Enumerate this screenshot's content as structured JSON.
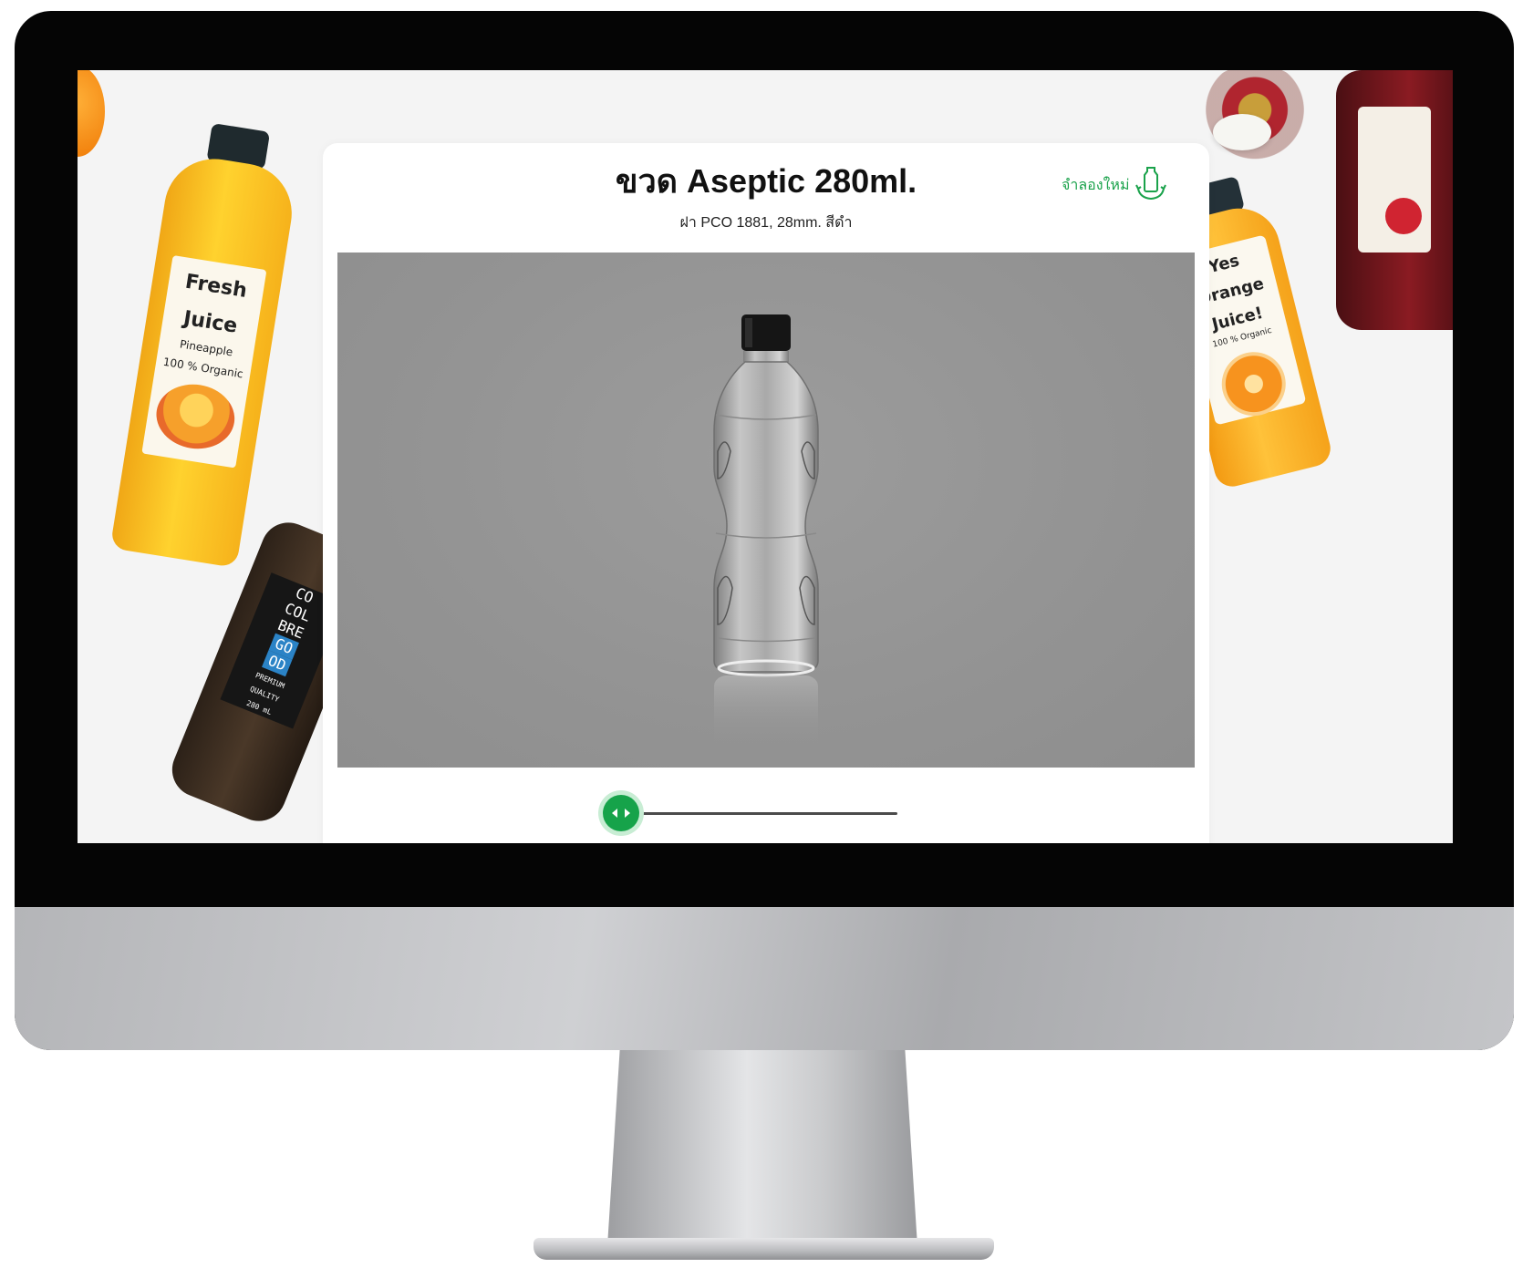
{
  "product": {
    "title": "ขวด Aseptic 280ml.",
    "subtitle": "ฝา PCO 1881, 28mm. สีดำ"
  },
  "actions": {
    "reset_label": "จำลองใหม่",
    "reset_icon": "bottle-reset-icon"
  },
  "viewer": {
    "model": "clear-pet-bottle-black-cap",
    "background_color": "#959595"
  },
  "slider": {
    "icon": "left-right-arrows-icon",
    "value": 0
  },
  "props": {
    "left_bottle_label": [
      "Fresh",
      "Juice",
      "Pineapple",
      "100 % Organic"
    ],
    "dark_bottle_label": [
      "CO",
      "COL",
      "BRE",
      "GO",
      "OD",
      "PREMIUM",
      "QUALITY",
      "280 mL"
    ],
    "right_bottle_label": [
      "Yes",
      "Orange",
      "Juice!",
      "100 %",
      "Organic"
    ]
  },
  "colors": {
    "accent": "#16a34a",
    "reset_text": "#1aa24b",
    "slider_track": "#4b4b4b",
    "screen_bg": "#f4f4f4"
  }
}
